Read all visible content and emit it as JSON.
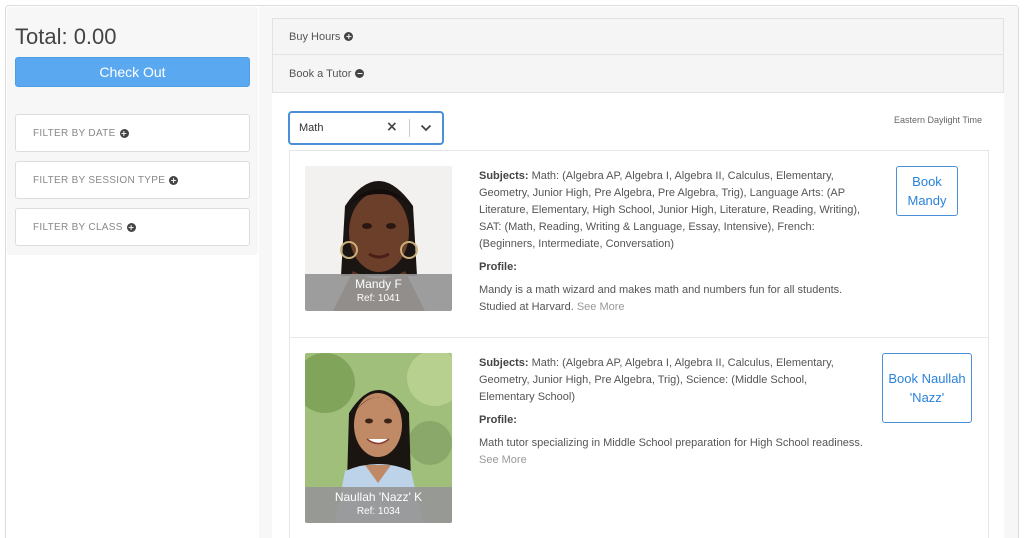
{
  "sidebar": {
    "total": "Total: 0.00",
    "checkout_label": "Check Out",
    "filters": [
      {
        "label": "FILTER BY DATE"
      },
      {
        "label": "FILTER BY SESSION TYPE"
      },
      {
        "label": "FILTER BY CLASS"
      }
    ]
  },
  "accordion": {
    "buy_hours": "Buy Hours",
    "book_tutor": "Book a Tutor"
  },
  "search": {
    "value": "Math",
    "clear_icon": "×",
    "chevron_icon": "⌄"
  },
  "timezone": "Eastern Daylight Time",
  "tutors": [
    {
      "name": "Mandy F",
      "ref": "Ref: 1041",
      "subjects_label": "Subjects:",
      "subjects": " Math: (Algebra AP, Algebra I, Algebra II, Calculus, Elementary, Geometry, Junior High, Pre Algebra, Pre Algebra, Trig), Language Arts: (AP Literature, Elementary, High School, Junior High, Literature, Reading, Writing), SAT: (Math, Reading, Writing & Language, Essay, Intensive), French: (Beginners, Intermediate, Conversation)",
      "profile_label": "Profile:",
      "profile": "Mandy is a math wizard and makes math and numbers fun for all students. Studied at Harvard.",
      "see_more": "See More",
      "book_label": "Book Mandy"
    },
    {
      "name": "Naullah 'Nazz' K",
      "ref": "Ref: 1034",
      "subjects_label": "Subjects:",
      "subjects": " Math: (Algebra AP, Algebra I, Algebra II, Calculus, Elementary, Geometry, Junior High, Pre Algebra, Trig), Science: (Middle School, Elementary School)",
      "profile_label": "Profile:",
      "profile": "Math tutor specializing in Middle School preparation for High School readiness.",
      "see_more": "See More",
      "book_label": "Book Naullah 'Nazz'"
    }
  ],
  "colors": {
    "accent": "#5aa9f0",
    "link": "#2b82d9"
  },
  "icons": {
    "plus": "plus-circle-icon",
    "minus": "minus-circle-icon"
  }
}
